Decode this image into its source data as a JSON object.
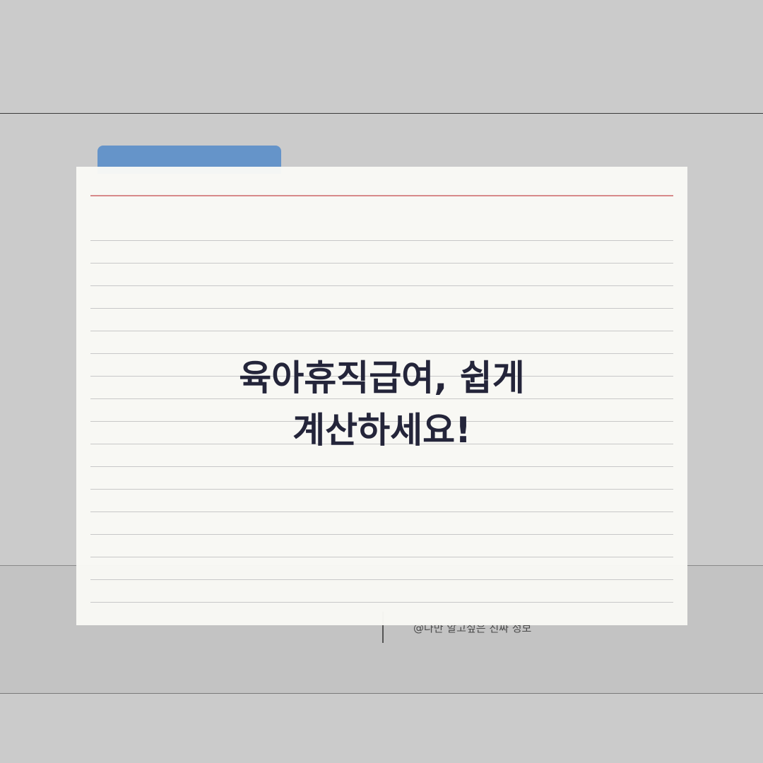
{
  "card": {
    "title_line1": "육아휴직급여, 쉽게",
    "title_line2": "계산하세요!"
  },
  "footer": {
    "credit": "@나만 알고싶은 진짜 정보"
  },
  "colors": {
    "background": "#cbcbcb",
    "tab": "#6594c9",
    "card": "#f9f9f5",
    "red_rule": "#d88a8a",
    "title_text": "#24253a"
  }
}
